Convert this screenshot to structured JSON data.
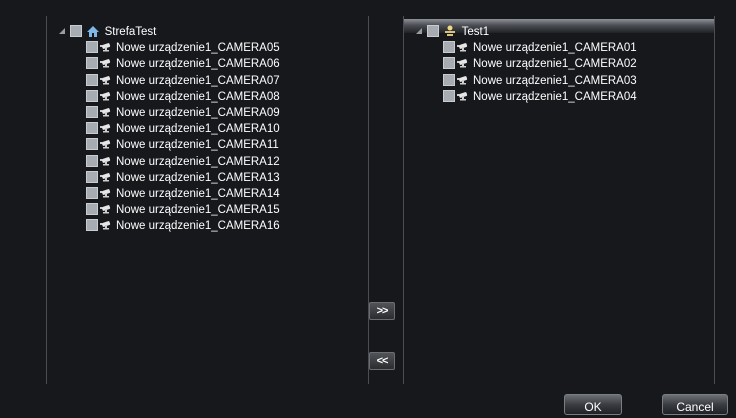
{
  "left_tree": {
    "root_label": "StrefaTest",
    "items": [
      "Nowe urządzenie1_CAMERA05",
      "Nowe urządzenie1_CAMERA06",
      "Nowe urządzenie1_CAMERA07",
      "Nowe urządzenie1_CAMERA08",
      "Nowe urządzenie1_CAMERA09",
      "Nowe urządzenie1_CAMERA10",
      "Nowe urządzenie1_CAMERA11",
      "Nowe urządzenie1_CAMERA12",
      "Nowe urządzenie1_CAMERA13",
      "Nowe urządzenie1_CAMERA14",
      "Nowe urządzenie1_CAMERA15",
      "Nowe urządzenie1_CAMERA16"
    ]
  },
  "right_tree": {
    "root_label": "Test1",
    "items": [
      "Nowe urządzenie1_CAMERA01",
      "Nowe urządzenie1_CAMERA02",
      "Nowe urządzenie1_CAMERA03",
      "Nowe urządzenie1_CAMERA04"
    ]
  },
  "buttons": {
    "add": ">>",
    "remove": "<<",
    "ok": "OK",
    "cancel": "Cancel"
  },
  "icons": {
    "left_root": "home-icon",
    "right_root": "group-icon",
    "camera": "camera-icon"
  },
  "colors": {
    "background": "#16181c",
    "checkbox": "#a7acb2",
    "border": "#4a4d52"
  }
}
